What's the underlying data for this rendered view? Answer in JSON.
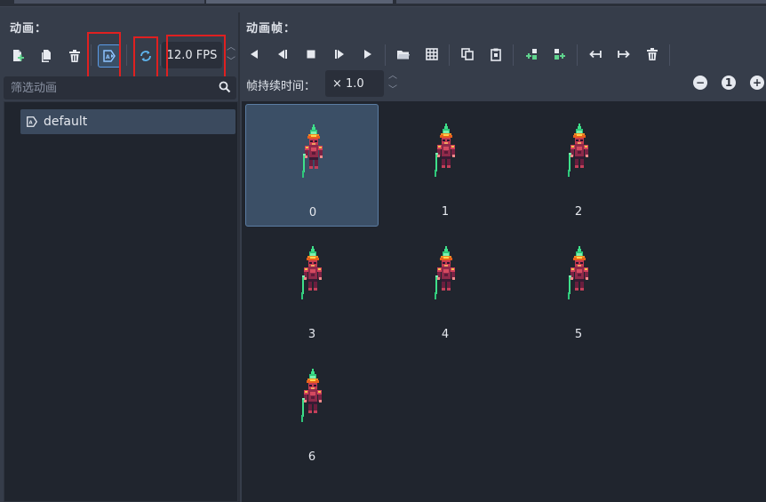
{
  "anim_panel": {
    "title": "动画：",
    "fps": "12.0 FPS",
    "filter_placeholder": "筛选动画",
    "animations": [
      {
        "name": "default"
      }
    ]
  },
  "frames_panel": {
    "title": "动画帧：",
    "duration_label": "帧持续时间：",
    "duration_value": "× 1.0",
    "zoom_reset": "1",
    "zoom_out": "−",
    "zoom_in": "+",
    "frames": [
      {
        "label": "0"
      },
      {
        "label": "1"
      },
      {
        "label": "2"
      },
      {
        "label": "3"
      },
      {
        "label": "4"
      },
      {
        "label": "5"
      },
      {
        "label": "6"
      }
    ]
  },
  "icons": {
    "accent": "#5b9be6",
    "highlight": "#e02020"
  }
}
